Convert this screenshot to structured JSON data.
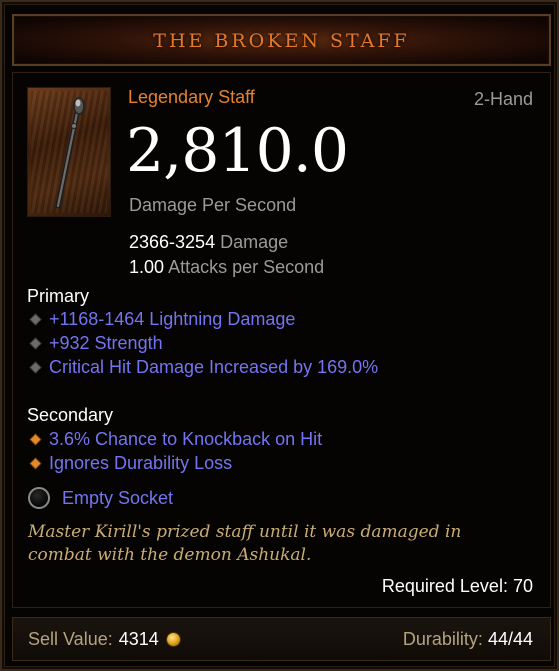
{
  "item": {
    "name": "THE BROKEN STAFF",
    "type": "Legendary Staff",
    "hand": "2-Hand",
    "dps": "2,810.0",
    "dps_label": "Damage Per Second",
    "damage_value": "2366-3254",
    "damage_label": "Damage",
    "aps_value": "1.00",
    "aps_label": "Attacks per Second"
  },
  "primary": {
    "title": "Primary",
    "affixes": [
      "+1168-1464 Lightning Damage",
      "+932 Strength",
      "Critical Hit Damage Increased by 169.0%"
    ]
  },
  "secondary": {
    "title": "Secondary",
    "affixes": [
      "3.6% Chance to Knockback on Hit",
      "Ignores Durability Loss"
    ]
  },
  "socket": {
    "label": "Empty Socket"
  },
  "flavor_text": "Master Kirill's prized staff until it was damaged in combat with the demon Ashukal.",
  "required_level": {
    "label": "Required Level:",
    "value": "70"
  },
  "footer": {
    "sell_label": "Sell Value:",
    "sell_value": "4314",
    "durability_label": "Durability:",
    "durability_value": "44/44"
  },
  "icons": {
    "item": "staff-icon",
    "socket": "empty-socket-icon",
    "gold": "gold-coin-icon",
    "bullet_primary": "grey-diamond-bullet-icon",
    "bullet_secondary": "orange-diamond-bullet-icon"
  },
  "colors": {
    "legendary_orange": "#e5822f",
    "affix_blue": "#7474f2",
    "flavor_gold": "#c9ac74",
    "label_grey": "#9a9a9a"
  }
}
